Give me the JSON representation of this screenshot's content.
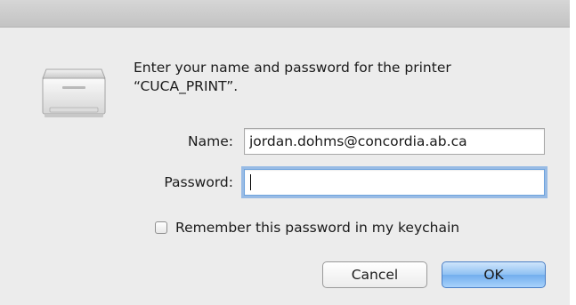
{
  "dialog": {
    "message": "Enter your name and password for the printer “CUCA_PRINT”.",
    "icon": "printer-icon"
  },
  "form": {
    "name_label": "Name:",
    "name_value": "jordan.dohms@concordia.ab.ca",
    "password_label": "Password:",
    "password_value": "",
    "remember_label": "Remember this password in my keychain",
    "remember_checked": false
  },
  "buttons": {
    "cancel_label": "Cancel",
    "ok_label": "OK"
  },
  "colors": {
    "sheet_background": "#ececec",
    "focus_ring": "#5494e0",
    "default_button": "#8ec0f3"
  }
}
